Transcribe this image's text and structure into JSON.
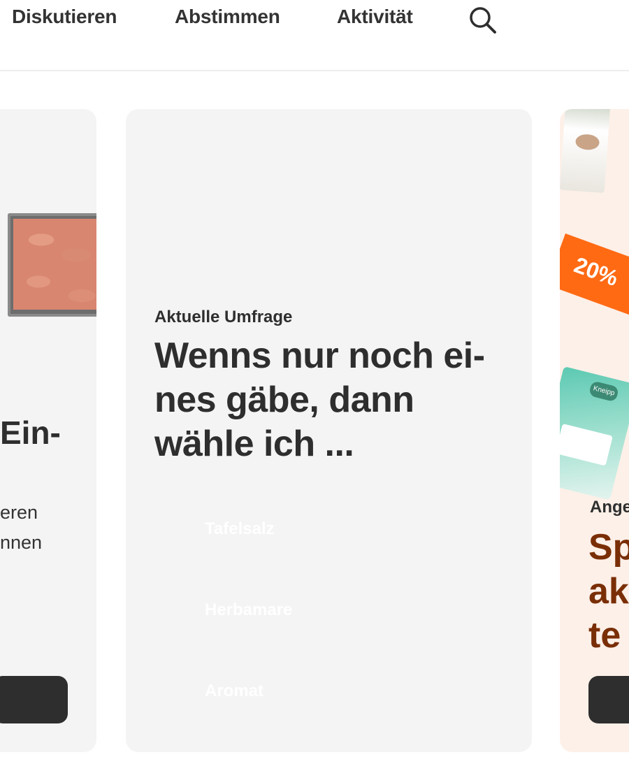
{
  "nav": {
    "items": [
      "Diskutieren",
      "Abstimmen",
      "Aktivität"
    ],
    "search_icon": "search-icon"
  },
  "cards": {
    "left": {
      "image": "meat-tray-image",
      "title_fragment": "Ein-",
      "text_lines": [
        "eren",
        "nnen"
      ]
    },
    "center": {
      "eyebrow": "Aktuelle Umfrage",
      "title": "Wenns nur noch ei-nes gäbe, dann wähle ich ...",
      "options": [
        "Tafelsalz",
        "Herbamare",
        "Aromat"
      ]
    },
    "right": {
      "badge": "20%",
      "eyebrow_fragment": "Ange",
      "title_lines": [
        "Sp",
        "ak",
        "te"
      ],
      "brand": "Kneipp"
    }
  },
  "colors": {
    "card_background": "#f4f4f4",
    "right_card_background": "#fdf0e8",
    "text_dark": "#2e2e2e",
    "accent_orange": "#ff6a13",
    "accent_brown": "#7a2e06",
    "button_dark": "#2e2e2e"
  }
}
